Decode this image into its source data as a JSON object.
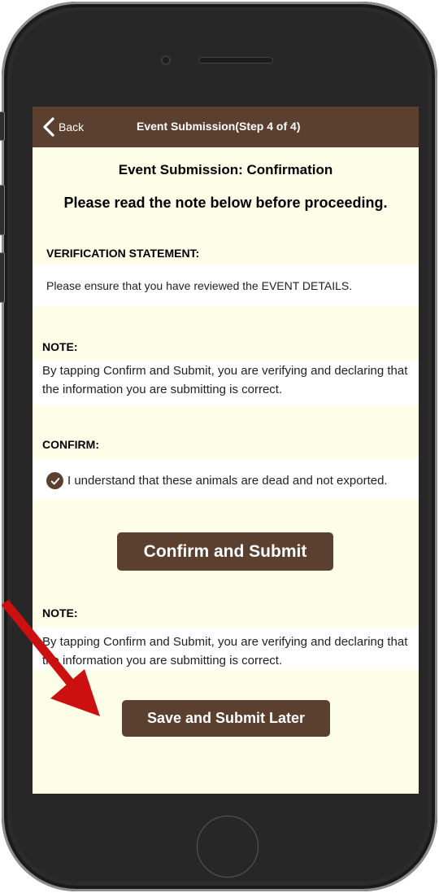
{
  "nav": {
    "back_label": "Back",
    "title": "Event Submission(Step 4 of 4)"
  },
  "header": {
    "title": "Event Submission: Confirmation",
    "subtitle": "Please read the note below before proceeding."
  },
  "verification": {
    "label": "VERIFICATION STATEMENT:",
    "text": "Please ensure that you have reviewed the EVENT DETAILS."
  },
  "note1": {
    "label": "NOTE:",
    "text": "By tapping Confirm and Submit, you are verifying and declaring that the information you are submitting is correct."
  },
  "confirm": {
    "label": "CONFIRM:",
    "checkbox_label": "I understand that these animals are dead and not exported.",
    "checked": true
  },
  "confirm_button": "Confirm and Submit",
  "note2": {
    "label": "NOTE:",
    "text": "By tapping Confirm and Submit, you are verifying and declaring that the information you are submitting is correct."
  },
  "save_button": "Save and Submit Later",
  "colors": {
    "accent": "#5b4030",
    "warning": "#e3001b",
    "background": "#fdfde8",
    "annotation_arrow": "#cc1010"
  }
}
